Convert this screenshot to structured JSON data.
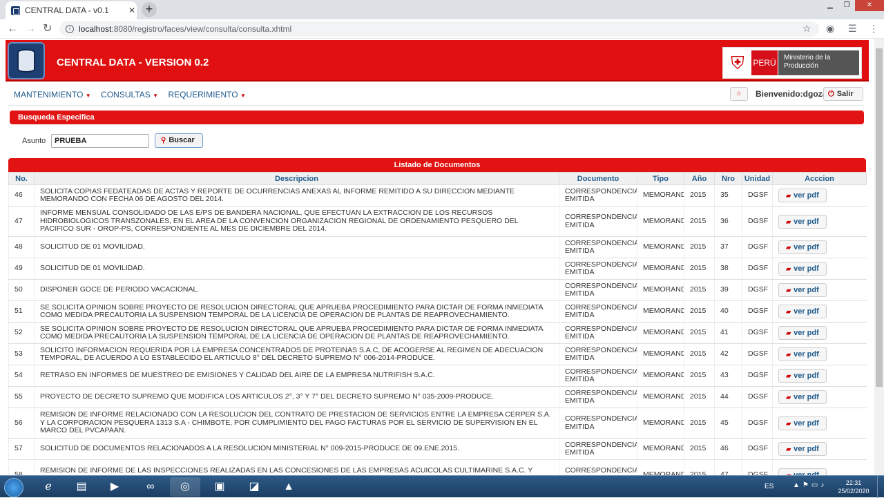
{
  "browser": {
    "tab_title": "CENTRAL DATA - v0.1",
    "url_host": "localhost",
    "url_path": ":8080/registro/faces/view/consulta/consulta.xhtml"
  },
  "app": {
    "title": "CENTRAL DATA - VERSION 0.2",
    "ministry_badge": "PERÚ",
    "ministry_name": "Ministerio de la Producción",
    "menu": [
      "MANTENIMIENTO",
      "CONSULTAS",
      "REQUERIMIENTO"
    ],
    "welcome": "Bienvenido:dgozar",
    "logout_label": "Salir"
  },
  "search": {
    "panel_title": "Busqueda Especifica",
    "label": "Asunto",
    "value": "PRUEBA",
    "button": "Buscar"
  },
  "documents": {
    "panel_title": "Listado de Documentos",
    "columns": [
      "No.",
      "Descripcion",
      "Documento",
      "Tipo",
      "Año",
      "Nro",
      "Unidad",
      "Acccion"
    ],
    "action_label": "ver pdf",
    "rows": [
      {
        "no": "46",
        "desc": "SOLICITA COPIAS FEDATEADAS DE ACTAS Y REPORTE DE OCURRENCIAS ANEXAS AL INFORME REMITIDO A SU DIRECCION MEDIANTE MEMORANDO CON FECHA 06 DE AGOSTO DEL 2014.",
        "doc": "CORRESPONDENCIA EMITIDA",
        "tipo": "MEMORANDO",
        "anio": "2015",
        "nro": "35",
        "unidad": "DGSF"
      },
      {
        "no": "47",
        "desc": "INFORME MENSUAL CONSOLIDADO DE LAS E/PS DE BANDERA NACIONAL, QUE EFECTUAN LA EXTRACCION DE LOS RECURSOS HIDROBIOLOGICOS TRANSZONALES, EN EL AREA DE LA CONVENCION ORGANIZACION REGIONAL DE ORDENAMIENTO PESQUERO DEL PACIFICO SUR - OROP-PS, CORRESPONDIENTE AL MES DE DICIEMBRE DEL 2014.",
        "doc": "CORRESPONDENCIA EMITIDA",
        "tipo": "MEMORANDO",
        "anio": "2015",
        "nro": "36",
        "unidad": "DGSF"
      },
      {
        "no": "48",
        "desc": "SOLICITUD DE 01 MOVILIDAD.",
        "doc": "CORRESPONDENCIA EMITIDA",
        "tipo": "MEMORANDO",
        "anio": "2015",
        "nro": "37",
        "unidad": "DGSF"
      },
      {
        "no": "49",
        "desc": "SOLICITUD DE 01 MOVILIDAD.",
        "doc": "CORRESPONDENCIA EMITIDA",
        "tipo": "MEMORANDO",
        "anio": "2015",
        "nro": "38",
        "unidad": "DGSF"
      },
      {
        "no": "50",
        "desc": "DISPONER GOCE DE PERIODO VACACIONAL.",
        "doc": "CORRESPONDENCIA EMITIDA",
        "tipo": "MEMORANDO",
        "anio": "2015",
        "nro": "39",
        "unidad": "DGSF"
      },
      {
        "no": "51",
        "desc": "SE SOLICITA OPINION SOBRE PROYECTO DE RESOLUCION DIRECTORAL QUE APRUEBA PROCEDIMIENTO PARA DICTAR DE FORMA INMEDIATA COMO MEDIDA PRECAUTORIA LA SUSPENSION TEMPORAL DE LA LICENCIA DE OPERACION DE PLANTAS DE REAPROVECHAMIENTO.",
        "doc": "CORRESPONDENCIA EMITIDA",
        "tipo": "MEMORANDO",
        "anio": "2015",
        "nro": "40",
        "unidad": "DGSF"
      },
      {
        "no": "52",
        "desc": "SE SOLICITA OPINION SOBRE PROYECTO DE RESOLUCION DIRECTORAL QUE APRUEBA PROCEDIMIENTO PARA DICTAR DE FORMA INMEDIATA COMO MEDIDA PRECAUTORIA LA SUSPENSION TEMPORAL DE LA LICENCIA DE OPERACION DE PLANTAS DE REAPROVECHAMIENTO.",
        "doc": "CORRESPONDENCIA EMITIDA",
        "tipo": "MEMORANDO",
        "anio": "2015",
        "nro": "41",
        "unidad": "DGSF"
      },
      {
        "no": "53",
        "desc": "SOLICITO INFORMACION REQUERIDA POR LA EMPRESA CONCENTRADOS DE PROTEINAS S.A.C, DE ACOGERSE AL REGIMEN DE ADECUACION TEMPORAL, DE ACUERDO A LO ESTABLECIDO EL ARTICULO 8° DEL DECRETO SUPREMO N° 006-2014-PRODUCE.",
        "doc": "CORRESPONDENCIA EMITIDA",
        "tipo": "MEMORANDO",
        "anio": "2015",
        "nro": "42",
        "unidad": "DGSF"
      },
      {
        "no": "54",
        "desc": "RETRASO EN INFORMES DE MUESTREO DE EMISIONES Y CALIDAD DEL AIRE DE LA EMPRESA NUTRIFISH S.A.C.",
        "doc": "CORRESPONDENCIA EMITIDA",
        "tipo": "MEMORANDO",
        "anio": "2015",
        "nro": "43",
        "unidad": "DGSF"
      },
      {
        "no": "55",
        "desc": "PROYECTO DE DECRETO SUPREMO QUE MODIFICA LOS ARTICULOS 2°, 3° Y 7° DEL DECRETO SUPREMO N° 035-2009-PRODUCE.",
        "doc": "CORRESPONDENCIA EMITIDA",
        "tipo": "MEMORANDO",
        "anio": "2015",
        "nro": "44",
        "unidad": "DGSF"
      },
      {
        "no": "56",
        "desc": "REMISION DE INFORME RELACIONADO CON LA RESOLUCION DEL CONTRATO DE PRESTACION DE SERVICIOS ENTRE LA EMPRESA CERPER S.A. Y LA CORPORACION PESQUERA 1313 S.A - CHIMBOTE, POR CUMPLIMIENTO DEL PAGO FACTURAS POR EL SERVICIO DE SUPERVISION EN EL MARCO DEL PVCAPAAN.",
        "doc": "CORRESPONDENCIA EMITIDA",
        "tipo": "MEMORANDO",
        "anio": "2015",
        "nro": "45",
        "unidad": "DGSF"
      },
      {
        "no": "57",
        "desc": "SOLICITUD DE DOCUMENTOS RELACIONADOS A LA RESOLUCION MINISTERIAL N° 009-2015-PRODUCE DE 09.ENE.2015.",
        "doc": "CORRESPONDENCIA EMITIDA",
        "tipo": "MEMORANDO",
        "anio": "2015",
        "nro": "46",
        "unidad": "DGSF"
      },
      {
        "no": "58",
        "desc": "REMISION DE INFORME DE LAS INSPECCIONES REALIZADAS EN LAS CONCESIONES DE LAS EMPRESAS ACUICOLAS CULTIMARINE S.A.C. Y ACUACULTIVOS DEL PACIFICO S.A.C UBICADO EN LA ENSENADA LA BOQUITA, LOCALIDAD DE SAMANCO, EL 26.NOV.2014, A FIN DE",
        "doc": "CORRESPONDENCIA EMITIDA",
        "tipo": "MEMORANDO",
        "anio": "2015",
        "nro": "47",
        "unidad": "DGSF"
      }
    ]
  },
  "taskbar": {
    "lang": "ES",
    "time": "22:31",
    "date": "25/02/2020"
  },
  "colors": {
    "brand_red": "#e01010",
    "link_blue": "#1f5a8c"
  }
}
